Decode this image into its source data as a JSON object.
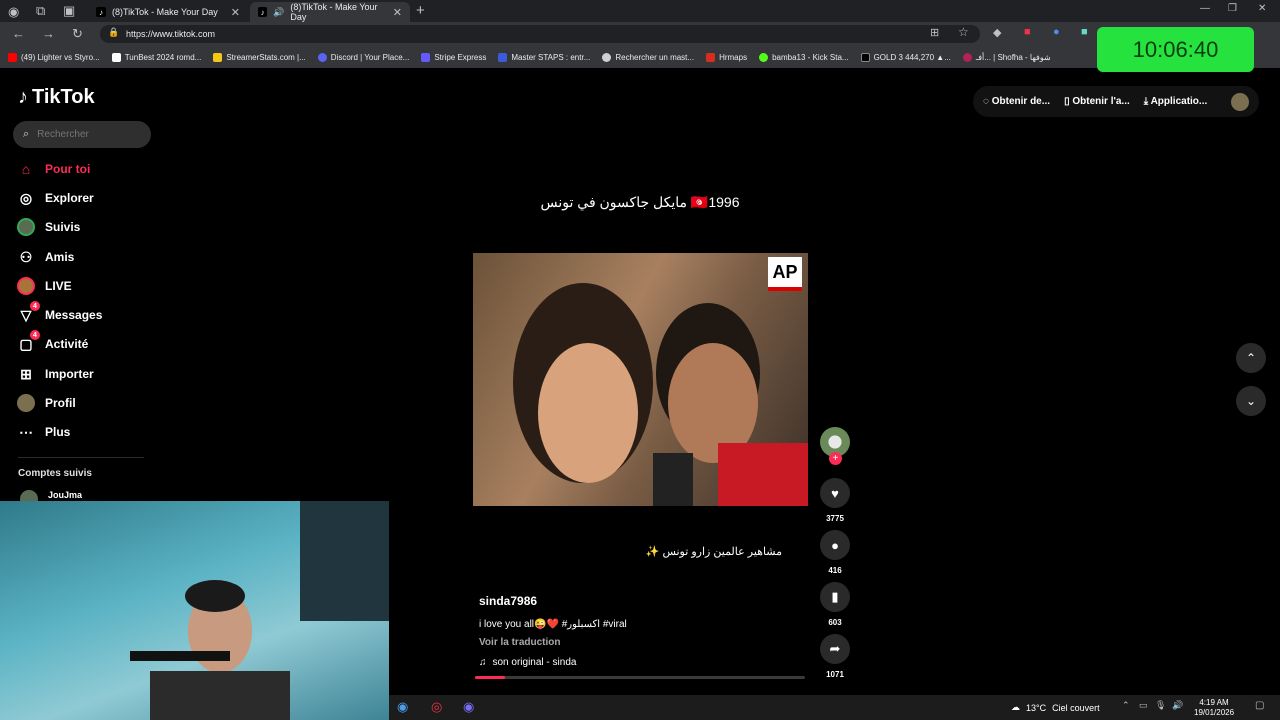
{
  "browser": {
    "tabs": [
      {
        "title": "(8)TikTok - Make Your Day",
        "active": false
      },
      {
        "title": "(8)TikTok - Make Your Day",
        "active": true
      }
    ],
    "url": "https://www.tiktok.com",
    "bookmarks": [
      {
        "label": "(49) Lighter vs Styro...",
        "color": "#ff0000"
      },
      {
        "label": "TunBest 2024 romd...",
        "color": "#ffffff"
      },
      {
        "label": "StreamerStats.com |...",
        "color": "#f5c518"
      },
      {
        "label": "Discord | Your Place...",
        "color": "#5865f2"
      },
      {
        "label": "Stripe Express",
        "color": "#635bff"
      },
      {
        "label": "Master STAPS : entr...",
        "color": "#3b5bdb"
      },
      {
        "label": "Rechercher un mast...",
        "color": "#d0d0d0"
      },
      {
        "label": "Hrmaps",
        "color": "#d62d20"
      },
      {
        "label": "bamba13 - Kick Sta...",
        "color": "#53fc18"
      },
      {
        "label": "GOLD 3 444,270 ▲...",
        "color": "#000000"
      },
      {
        "label": "أفـ... | Shofha - شوفها",
        "color": "#b22255"
      }
    ]
  },
  "overlay": {
    "clock": "10:06:40"
  },
  "tiktok": {
    "logo": "TikTok",
    "search_placeholder": "Rechercher",
    "nav": [
      {
        "label": "Pour toi",
        "icon": "home-icon",
        "active": true
      },
      {
        "label": "Explorer",
        "icon": "compass-icon"
      },
      {
        "label": "Suivis",
        "icon": "following-avatar-icon"
      },
      {
        "label": "Amis",
        "icon": "friends-icon"
      },
      {
        "label": "LIVE",
        "icon": "live-icon"
      },
      {
        "label": "Messages",
        "icon": "messages-icon",
        "badge": "4"
      },
      {
        "label": "Activité",
        "icon": "activity-icon",
        "badge": "4"
      },
      {
        "label": "Importer",
        "icon": "upload-icon"
      },
      {
        "label": "Profil",
        "icon": "profile-avatar-icon"
      },
      {
        "label": "Plus",
        "icon": "more-icon"
      }
    ],
    "following_heading": "Comptes suivis",
    "following": [
      {
        "name": "JouJma"
      }
    ],
    "top_actions": [
      {
        "label": "Obtenir de...",
        "icon": "coin-icon"
      },
      {
        "label": "Obtenir l'a...",
        "icon": "phone-icon"
      },
      {
        "label": "Applicatio...",
        "icon": "download-icon"
      }
    ],
    "video": {
      "caption": "🇹🇳1996 مايكل جاكسون  في تونس",
      "watermark": "AP",
      "subcaption": "مشاهير عالمين زارو تونس ✨",
      "author": "sinda7986",
      "description": "i love you all😜❤️ #اكسبلور #viral",
      "translate": "Voir la traduction",
      "sound": "son original - sinda",
      "progress": 0.09,
      "likes": "3775",
      "comments": "416",
      "saves": "603",
      "shares": "1071"
    }
  },
  "taskbar": {
    "temperature": "13°C",
    "weather": "Ciel couvert",
    "time": "4:19 AM",
    "date": "19/01/2026"
  }
}
